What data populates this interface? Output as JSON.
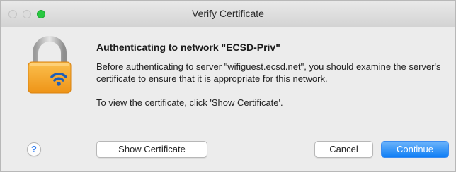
{
  "window": {
    "title": "Verify Certificate"
  },
  "dialog": {
    "icon": "padlock-wifi-icon",
    "heading": "Authenticating to network \"ECSD-Priv\"",
    "message": "Before authenticating to server \"wifiguest.ecsd.net\", you should examine the server's certificate to ensure that it is appropriate for this network.",
    "instruction": "To view the certificate, click 'Show Certificate'."
  },
  "buttons": {
    "help": "?",
    "show_certificate": "Show Certificate",
    "cancel": "Cancel",
    "continue": "Continue"
  },
  "colors": {
    "accent": "#1a82f6",
    "lock_body": "#f4a623",
    "close_light": "#dcdcdc",
    "maximize_light": "#28c840"
  }
}
